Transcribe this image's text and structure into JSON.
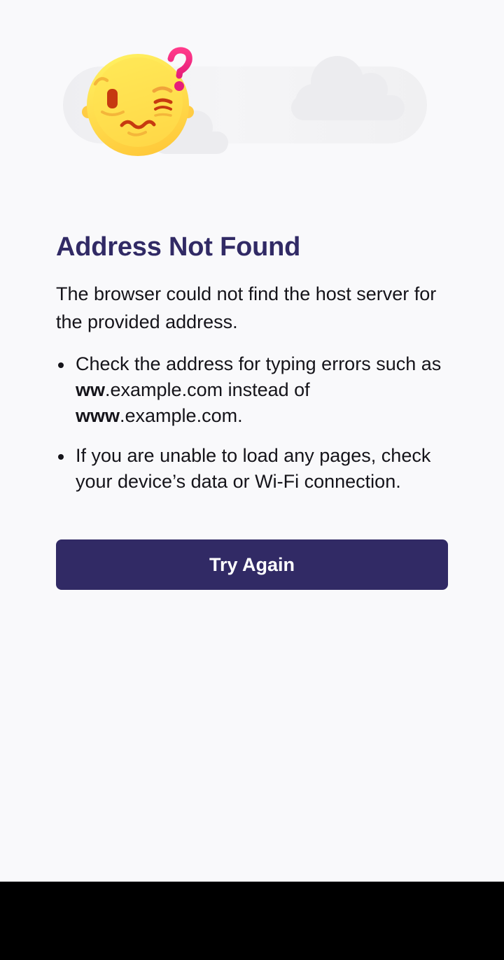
{
  "error": {
    "title": "Address Not Found",
    "description": "The browser could not find the host server for the provided address.",
    "tip1": {
      "prefix": "Check the address for typing errors such as ",
      "bold1": "ww",
      "mid": ".example.com instead of ",
      "bold2": "www",
      "suffix": ".example.com."
    },
    "tip2": "If you are unable to load any pages, check your device’s data or Wi-Fi connection.",
    "button_label": "Try Again"
  },
  "colors": {
    "background": "#f9f9fb",
    "title": "#312a65",
    "button": "#312a65",
    "button_text": "#ffffff",
    "body_text": "#15141a",
    "nav_bar": "#000000"
  },
  "icons": {
    "illustration": "confused-face-with-question-mark",
    "decor": "cloud"
  }
}
